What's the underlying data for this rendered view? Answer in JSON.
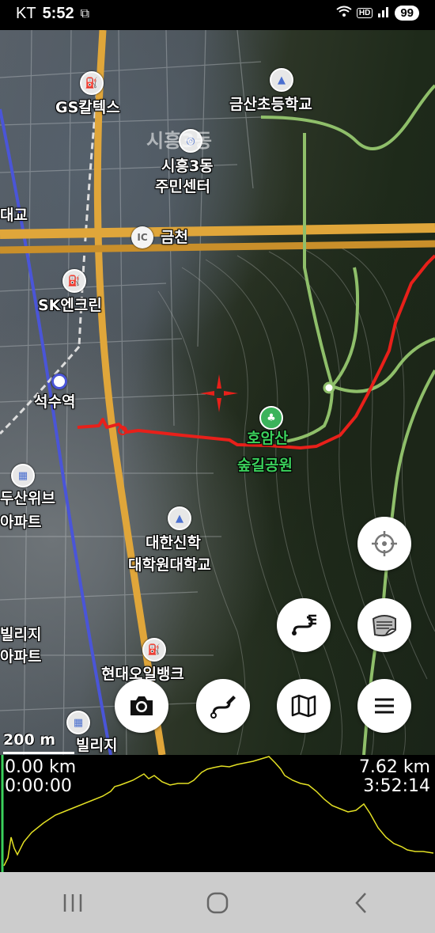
{
  "status_bar": {
    "carrier": "KT",
    "time": "5:52",
    "network": "HD",
    "battery": "99"
  },
  "map": {
    "labels": {
      "gs": "GS칼텍스",
      "school": "금산초등학교",
      "district_big": "시흥3동",
      "center_1": "시흥3동",
      "center_2": "주민센터",
      "bridge": "대교",
      "ic_badge": "IC",
      "ic_name": "금천",
      "sk": "SK엔크린",
      "station": "석수역",
      "park_1": "호암산",
      "park_2": "숲길공원",
      "apt_1": "두산위브",
      "apt_2": "아파트",
      "univ_1": "대한신학",
      "univ_2": "대학원대학교",
      "village": "빌리지",
      "village_apt": "아파트",
      "oilbank": "현대오일뱅크",
      "village_2": "빌리지"
    },
    "scale_label": "200 m"
  },
  "buttons": {
    "locate": "locate-icon",
    "layers": "layers-icon",
    "route": "route-list-icon",
    "camera": "camera-icon",
    "draw_route": "draw-route-icon",
    "map": "map-icon",
    "menu": "menu-icon"
  },
  "profile": {
    "start_distance": "0.00 km",
    "start_time": "0:00:00",
    "total_distance": "7.62 km",
    "total_time": "3:52:14"
  },
  "colors": {
    "track": "#e8201a",
    "trail": "#8fbf6a",
    "elevation": "#e3e024"
  }
}
